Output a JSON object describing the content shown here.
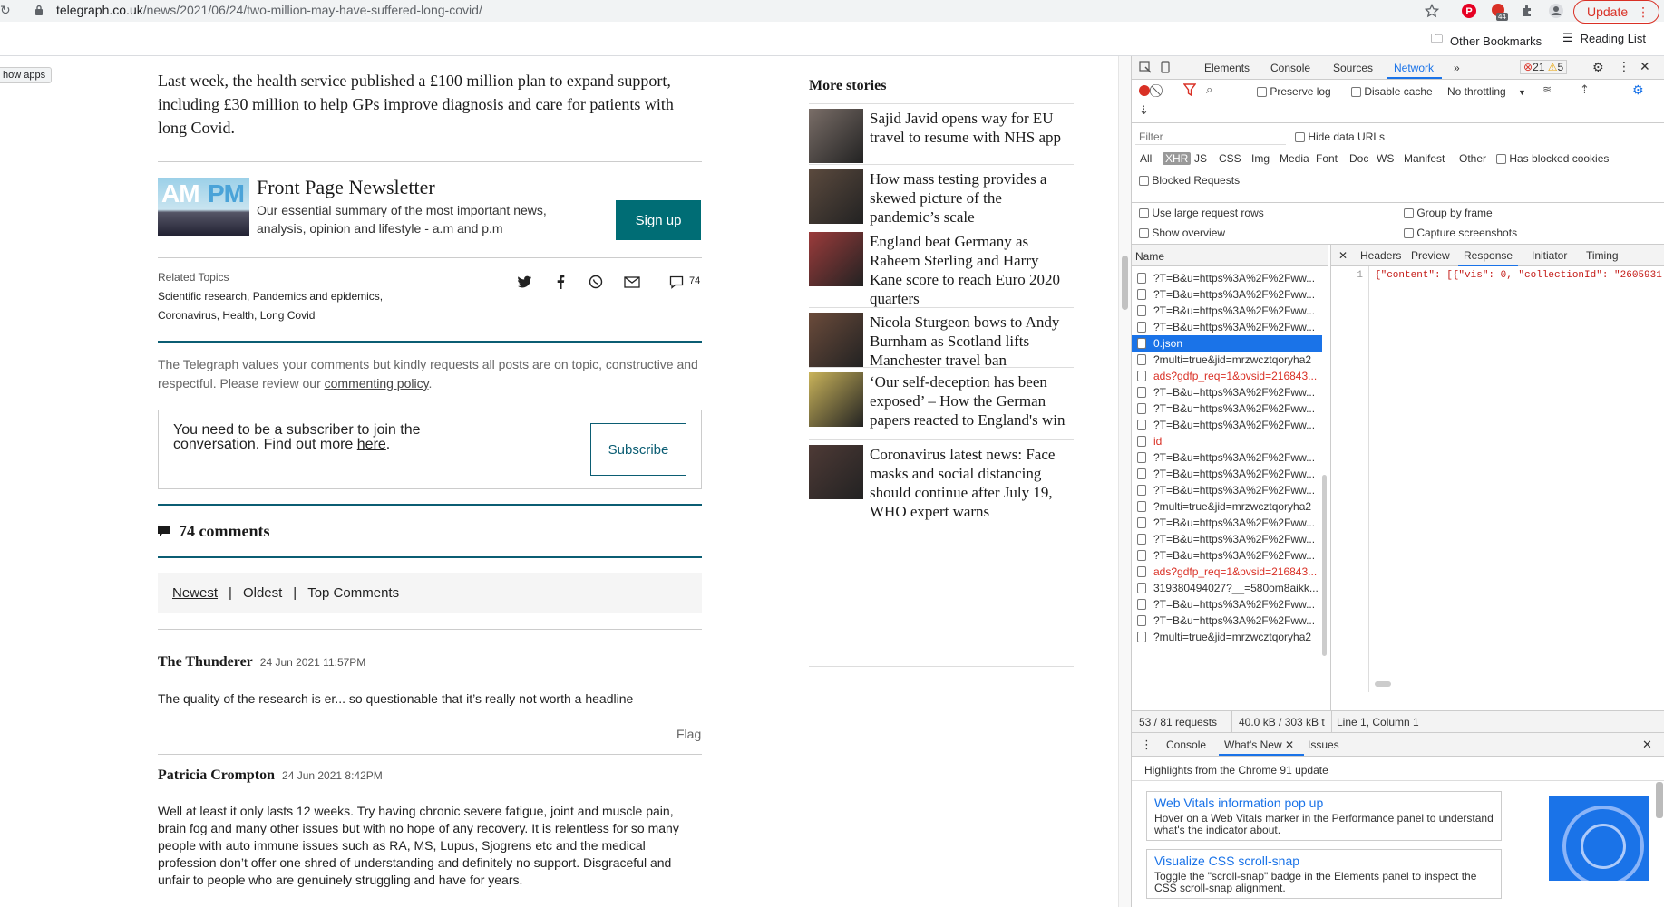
{
  "browser": {
    "url_domain": "telegraph.co.uk",
    "url_path": "/news/2021/06/24/two-million-may-have-suffered-long-covid/",
    "update_label": "Update",
    "ext_badge": "44",
    "bookmarks": {
      "other": "Other Bookmarks",
      "reading_list": "Reading List"
    },
    "apps_tooltip": "how apps"
  },
  "article": {
    "lead_paragraph": "Last week, the health service published a £100 million plan to expand support, including £30 million to help GPs improve diagnosis and care for patients with long Covid.",
    "newsletter": {
      "image_text_left": "AM",
      "image_text_right": "PM",
      "title": "Front Page Newsletter",
      "description": "Our essential summary of the most important news, analysis, opinion and lifestyle - a.m and p.m",
      "signup_label": "Sign up"
    },
    "related_topics_label": "Related Topics",
    "related_topics": "Scientific research, Pandemics and epidemics, Coronavirus, Health, Long Covid",
    "comment_count_badge": "74",
    "policy_text": "The Telegraph values your comments but kindly requests all posts are on topic, constructive and respectful. Please review our ",
    "policy_link": "commenting policy",
    "policy_end": ".",
    "subscribe_text": "You need to be a subscriber to join the conversation. Find out more ",
    "subscribe_link": "here",
    "subscribe_end": ".",
    "subscribe_label": "Subscribe",
    "comments_title": "74 comments",
    "sort": {
      "newest": "Newest",
      "sep": "|",
      "oldest": "Oldest",
      "top": "Top Comments"
    },
    "comments": [
      {
        "author": "The Thunderer",
        "date": "24 Jun 2021 11:57PM",
        "body": "The quality of the research is er... so questionable that it’s really not worth a headline"
      },
      {
        "author": "Patricia Crompton",
        "date": "24 Jun 2021 8:42PM",
        "body": "Well at least it only lasts 12 weeks. Try having chronic severe fatigue, joint and muscle pain, brain fog and many other issues but with no hope of any recovery. It is relentless for so many people with auto immune issues such as RA, MS, Lupus, Sjogrens etc and the medical profession don’t offer one shred of understanding and definitely no support. Disgraceful and unfair to people who are genuinely struggling and have for years."
      }
    ],
    "flag_label": "Flag"
  },
  "more_stories": {
    "title": "More stories",
    "items": [
      {
        "title": "Sajid Javid opens way for EU travel to resume with NHS app",
        "color": "#7a6e68"
      },
      {
        "title": "How mass testing provides a skewed picture of the pandemic’s scale",
        "color": "#5b4a3e"
      },
      {
        "title": "England beat Germany as Raheem Sterling and Harry Kane score to reach Euro 2020 quarters",
        "color": "#9b3b3b"
      },
      {
        "title": "Nicola Sturgeon bows to Andy Burnham as Scotland lifts Manchester travel ban",
        "color": "#6b4b3b"
      },
      {
        "title": "‘Our self-deception has been exposed’ – How the German papers reacted to England's win",
        "color": "#c9b35a"
      },
      {
        "title": "Coronavirus latest news: Face masks and social distancing should continue after July 19, WHO expert warns",
        "color": "#4e3a36"
      }
    ]
  },
  "devtools": {
    "tabs": [
      "Elements",
      "Console",
      "Sources",
      "Network"
    ],
    "more_tabs": "»",
    "errors": "21",
    "warnings": "5",
    "toolbar": {
      "preserve_log": "Preserve log",
      "disable_cache": "Disable cache",
      "throttling": "No throttling"
    },
    "filter_placeholder": "Filter",
    "hide_data_urls": "Hide data URLs",
    "types": [
      "All",
      "XHR",
      "JS",
      "CSS",
      "Img",
      "Media",
      "Font",
      "Doc",
      "WS",
      "Manifest",
      "Other"
    ],
    "has_blocked_cookies": "Has blocked cookies",
    "blocked_requests": "Blocked Requests",
    "opts": {
      "large_rows": "Use large request rows",
      "group_frame": "Group by frame",
      "overview": "Show overview",
      "screenshots": "Capture screenshots"
    },
    "name_header": "Name",
    "requests": [
      {
        "name": "?T=B&u=https%3A%2F%2Fww...",
        "state": "normal"
      },
      {
        "name": "?T=B&u=https%3A%2F%2Fww...",
        "state": "normal"
      },
      {
        "name": "?T=B&u=https%3A%2F%2Fww...",
        "state": "normal"
      },
      {
        "name": "?T=B&u=https%3A%2F%2Fww...",
        "state": "normal"
      },
      {
        "name": "0.json",
        "state": "selected"
      },
      {
        "name": "?multi=true&jid=mrzwcztqoryha2",
        "state": "normal"
      },
      {
        "name": "ads?gdfp_req=1&pvsid=216843...",
        "state": "error"
      },
      {
        "name": "?T=B&u=https%3A%2F%2Fww...",
        "state": "normal"
      },
      {
        "name": "?T=B&u=https%3A%2F%2Fww...",
        "state": "normal"
      },
      {
        "name": "?T=B&u=https%3A%2F%2Fww...",
        "state": "normal"
      },
      {
        "name": "id",
        "state": "error"
      },
      {
        "name": "?T=B&u=https%3A%2F%2Fww...",
        "state": "normal"
      },
      {
        "name": "?T=B&u=https%3A%2F%2Fww...",
        "state": "normal"
      },
      {
        "name": "?T=B&u=https%3A%2F%2Fww...",
        "state": "normal"
      },
      {
        "name": "?multi=true&jid=mrzwcztqoryha2",
        "state": "normal"
      },
      {
        "name": "?T=B&u=https%3A%2F%2Fww...",
        "state": "normal"
      },
      {
        "name": "?T=B&u=https%3A%2F%2Fww...",
        "state": "normal"
      },
      {
        "name": "?T=B&u=https%3A%2F%2Fww...",
        "state": "normal"
      },
      {
        "name": "ads?gdfp_req=1&pvsid=216843...",
        "state": "error"
      },
      {
        "name": "319380494027?__=580om8aikk...",
        "state": "normal"
      },
      {
        "name": "?T=B&u=https%3A%2F%2Fww...",
        "state": "normal"
      },
      {
        "name": "?T=B&u=https%3A%2F%2Fww...",
        "state": "normal"
      },
      {
        "name": "?multi=true&jid=mrzwcztqoryha2",
        "state": "normal"
      }
    ],
    "detail_tabs": [
      "Headers",
      "Preview",
      "Response",
      "Initiator",
      "Timing"
    ],
    "line_number": "1",
    "response_code": "{\"content\": [{\"vis\": 0, \"collectionId\": \"2605931",
    "status": {
      "requests": "53 / 81 requests",
      "transferred": "40.0 kB / 303 kB t",
      "position": "Line 1, Column 1"
    },
    "drawer": {
      "tabs": [
        "Console",
        "What's New",
        "Issues"
      ],
      "highlight": "Highlights from the Chrome 91 update",
      "cards": [
        {
          "title": "Web Vitals information pop up",
          "desc": "Hover on a Web Vitals marker in the Performance panel to understand what's the indicator about."
        },
        {
          "title": "Visualize CSS scroll-snap",
          "desc": "Toggle the \"scroll-snap\" badge in the Elements panel to inspect the CSS scroll-snap alignment."
        }
      ]
    }
  },
  "colors": {
    "accent_teal": "#006d75",
    "devtools_blue": "#1a73e8",
    "error_red": "#d93025"
  }
}
